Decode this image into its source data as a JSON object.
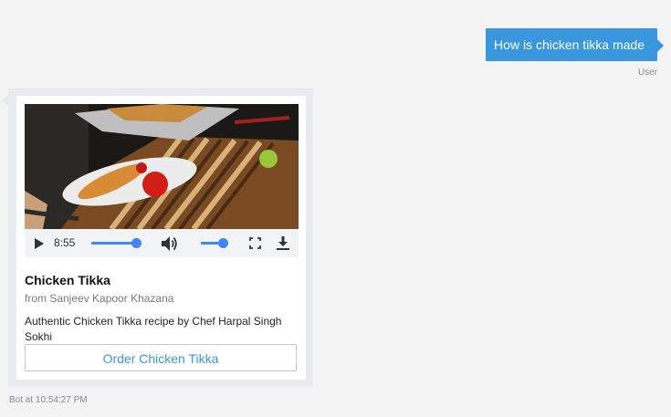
{
  "user_message": {
    "text": "How is chicken tikka made",
    "sender": "User"
  },
  "bot_message": {
    "video": {
      "current_time": "8:55",
      "progress": 0.98,
      "volume": 1.0
    },
    "title": "Chicken Tikka",
    "subtitle": "from Sanjeev Kapoor Khazana",
    "description": "Authentic Chicken Tikka recipe by Chef Harpal Singh Sokhi",
    "button_label": "Order Chicken Tikka",
    "timestamp": "Bot at 10:54:27 PM"
  },
  "colors": {
    "accent": "#3a96dd",
    "slider": "#4285f4",
    "background": "#f3f3f3"
  },
  "icons": [
    "play-icon",
    "volume-icon",
    "fullscreen-icon",
    "download-icon"
  ]
}
